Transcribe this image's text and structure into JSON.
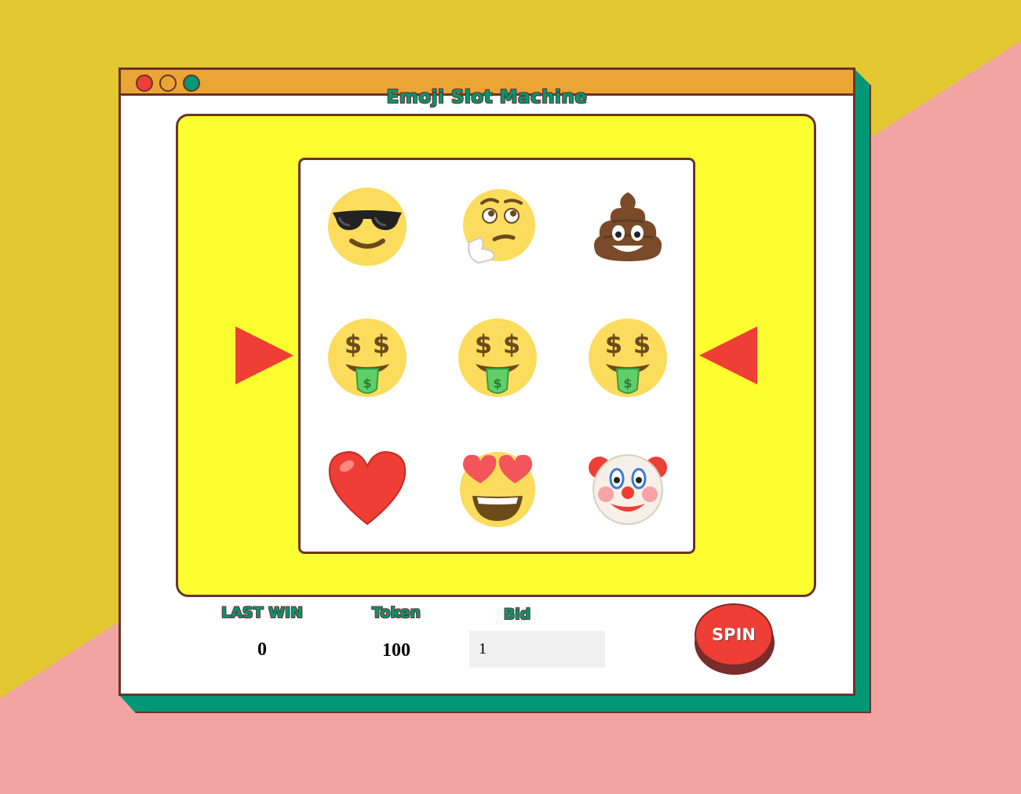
{
  "app": {
    "title": "Emoji Slot Machine"
  },
  "colors": {
    "background_yellow": "#e3c832",
    "background_pink": "#f2a4a3",
    "titlebar": "#eaa534",
    "machine": "#fcfe2f",
    "accent_green": "#009775",
    "accent_red": "#ef3e35",
    "outline": "#6a3328"
  },
  "reels": [
    [
      "cool-sunglasses",
      "thinking-face",
      "pile-of-poo"
    ],
    [
      "money-mouth-face",
      "money-mouth-face",
      "money-mouth-face"
    ],
    [
      "red-heart",
      "heart-eyes-face",
      "clown-face"
    ]
  ],
  "stats": {
    "last_win_label": "LAST WIN",
    "last_win_value": "0",
    "token_label": "Token",
    "token_value": "100",
    "bid_label": "Bid",
    "bid_value": "1"
  },
  "spin": {
    "label": "SPIN"
  }
}
